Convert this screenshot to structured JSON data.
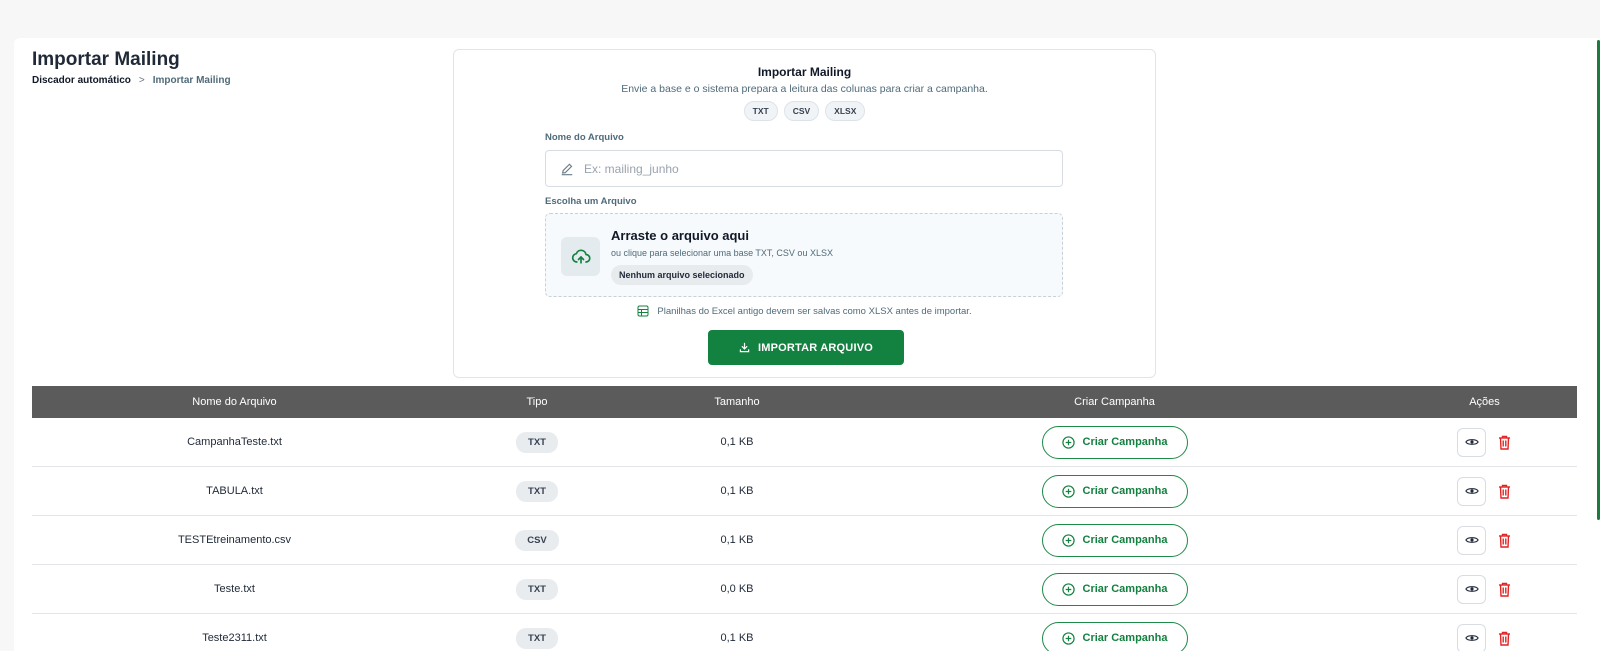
{
  "header": {
    "title": "Importar Mailing",
    "breadcrumb": {
      "root": "Discador automático",
      "separator": ">",
      "current": "Importar Mailing"
    }
  },
  "import_panel": {
    "title": "Importar Mailing",
    "subtitle": "Envie a base e o sistema prepara a leitura das colunas para criar a campanha.",
    "formats": [
      "TXT",
      "CSV",
      "XLSX"
    ],
    "name_label": "Nome do Arquivo",
    "name_placeholder": "Ex: mailing_junho",
    "name_value": "",
    "file_label": "Escolha um Arquivo",
    "dropzone_title": "Arraste o arquivo aqui",
    "dropzone_subtitle": "ou clique para selecionar uma base TXT, CSV ou XLSX",
    "dropzone_status": "Nenhum arquivo selecionado",
    "hint": "Planilhas do Excel antigo devem ser salvas como XLSX antes de importar.",
    "import_button": "IMPORTAR ARQUIVO"
  },
  "table": {
    "columns": [
      "Nome do Arquivo",
      "Tipo",
      "Tamanho",
      "Criar Campanha",
      "Ações"
    ],
    "create_label": "Criar Campanha",
    "rows": [
      {
        "name": "CampanhaTeste.txt",
        "type": "TXT",
        "size": "0,1 KB"
      },
      {
        "name": "TABULA.txt",
        "type": "TXT",
        "size": "0,1 KB"
      },
      {
        "name": "TESTEtreinamento.csv",
        "type": "CSV",
        "size": "0,1 KB"
      },
      {
        "name": "Teste.txt",
        "type": "TXT",
        "size": "0,0 KB"
      },
      {
        "name": "Teste2311.txt",
        "type": "TXT",
        "size": "0,1 KB"
      }
    ]
  },
  "colors": {
    "primary_green": "#13813f",
    "header_gray": "#5b5b5b",
    "danger_red": "#e02424"
  },
  "icons": [
    "pencil-icon",
    "cloud-upload-icon",
    "spreadsheet-icon",
    "download-icon",
    "plus-circle-icon",
    "eye-icon",
    "trash-icon"
  ]
}
